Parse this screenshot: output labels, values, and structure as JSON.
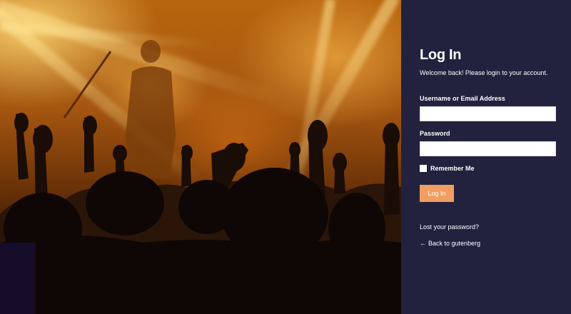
{
  "hero": {
    "image_alt": "concert crowd with raised hands under warm stage lights",
    "colors": {
      "light": "#ffc45a",
      "shadow": "#0b0606"
    }
  },
  "login": {
    "title": "Log In",
    "welcome": "Welcome back! Please login to your account.",
    "username_label": "Username or Email Address",
    "username_value": "",
    "password_label": "Password",
    "password_value": "",
    "remember_label": "Remember Me",
    "submit_label": "Log In",
    "lost_password": "Lost your password?",
    "back_arrow": "←",
    "back_link": "Back to gutenberg"
  },
  "colors": {
    "panel_bg": "#22223f",
    "button_bg": "#f29e61",
    "text": "#ffffff"
  }
}
